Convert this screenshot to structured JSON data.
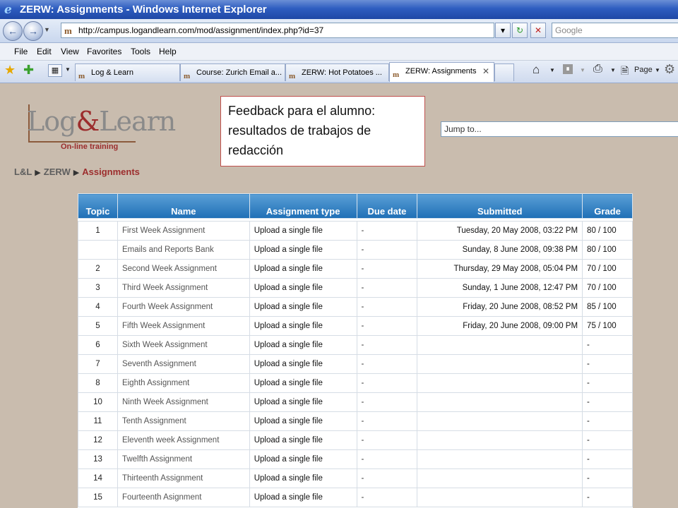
{
  "window": {
    "title": "ZERW: Assignments - Windows Internet Explorer"
  },
  "address": {
    "url": "http://campus.logandlearn.com/mod/assignment/index.php?id=37",
    "search_placeholder": "Google"
  },
  "menu": [
    "File",
    "Edit",
    "View",
    "Favorites",
    "Tools",
    "Help"
  ],
  "tabs": [
    {
      "label": "Log & Learn"
    },
    {
      "label": "Course: Zurich Email a..."
    },
    {
      "label": "ZERW: Hot Potatoes ..."
    },
    {
      "label": "ZERW: Assignments"
    }
  ],
  "toolbar_right": {
    "page_label": "Page"
  },
  "site": {
    "logo_text": "Log&Learn",
    "logo_tagline": "On-line training",
    "jump_label": "Jump to..."
  },
  "note": {
    "text": "Feedback para el alumno: resultados de trabajos de redacción"
  },
  "breadcrumb": [
    "L&L",
    "ZERW",
    "Assignments"
  ],
  "table": {
    "headers": [
      "Topic",
      "Name",
      "Assignment type",
      "Due date",
      "Submitted",
      "Grade"
    ],
    "rows": [
      [
        "1",
        "First Week Assignment",
        "Upload a single file",
        "-",
        "Tuesday, 20 May 2008, 03:22 PM",
        "80 / 100"
      ],
      [
        "",
        "Emails and Reports Bank",
        "Upload a single file",
        "-",
        "Sunday, 8 June 2008, 09:38 PM",
        "80 / 100"
      ],
      [
        "2",
        "Second Week Assignment",
        "Upload a single file",
        "-",
        "Thursday, 29 May 2008, 05:04 PM",
        "70 / 100"
      ],
      [
        "3",
        "Third Week Assignment",
        "Upload a single file",
        "-",
        "Sunday, 1 June 2008, 12:47 PM",
        "70 / 100"
      ],
      [
        "4",
        "Fourth Week Assignment",
        "Upload a single file",
        "-",
        "Friday, 20 June 2008, 08:52 PM",
        "85 / 100"
      ],
      [
        "5",
        "Fifth Week Assignment",
        "Upload a single file",
        "-",
        "Friday, 20 June 2008, 09:00 PM",
        "75 / 100"
      ],
      [
        "6",
        "Sixth Week Assignment",
        "Upload a single file",
        "-",
        "",
        "-"
      ],
      [
        "7",
        "Seventh Assignment",
        "Upload a single file",
        "-",
        "",
        "-"
      ],
      [
        "8",
        "Eighth Assignment",
        "Upload a single file",
        "-",
        "",
        "-"
      ],
      [
        "10",
        "Ninth Week Assignment",
        "Upload a single file",
        "-",
        "",
        "-"
      ],
      [
        "11",
        "Tenth Assignment",
        "Upload a single file",
        "-",
        "",
        "-"
      ],
      [
        "12",
        "Eleventh week Assignment",
        "Upload a single file",
        "-",
        "",
        "-"
      ],
      [
        "13",
        "Twelfth Assignment",
        "Upload a single file",
        "-",
        "",
        "-"
      ],
      [
        "14",
        "Thirteenth Assignment",
        "Upload a single file",
        "-",
        "",
        "-"
      ],
      [
        "15",
        "Fourteenth Asignment",
        "Upload a single file",
        "-",
        "",
        "-"
      ]
    ]
  }
}
